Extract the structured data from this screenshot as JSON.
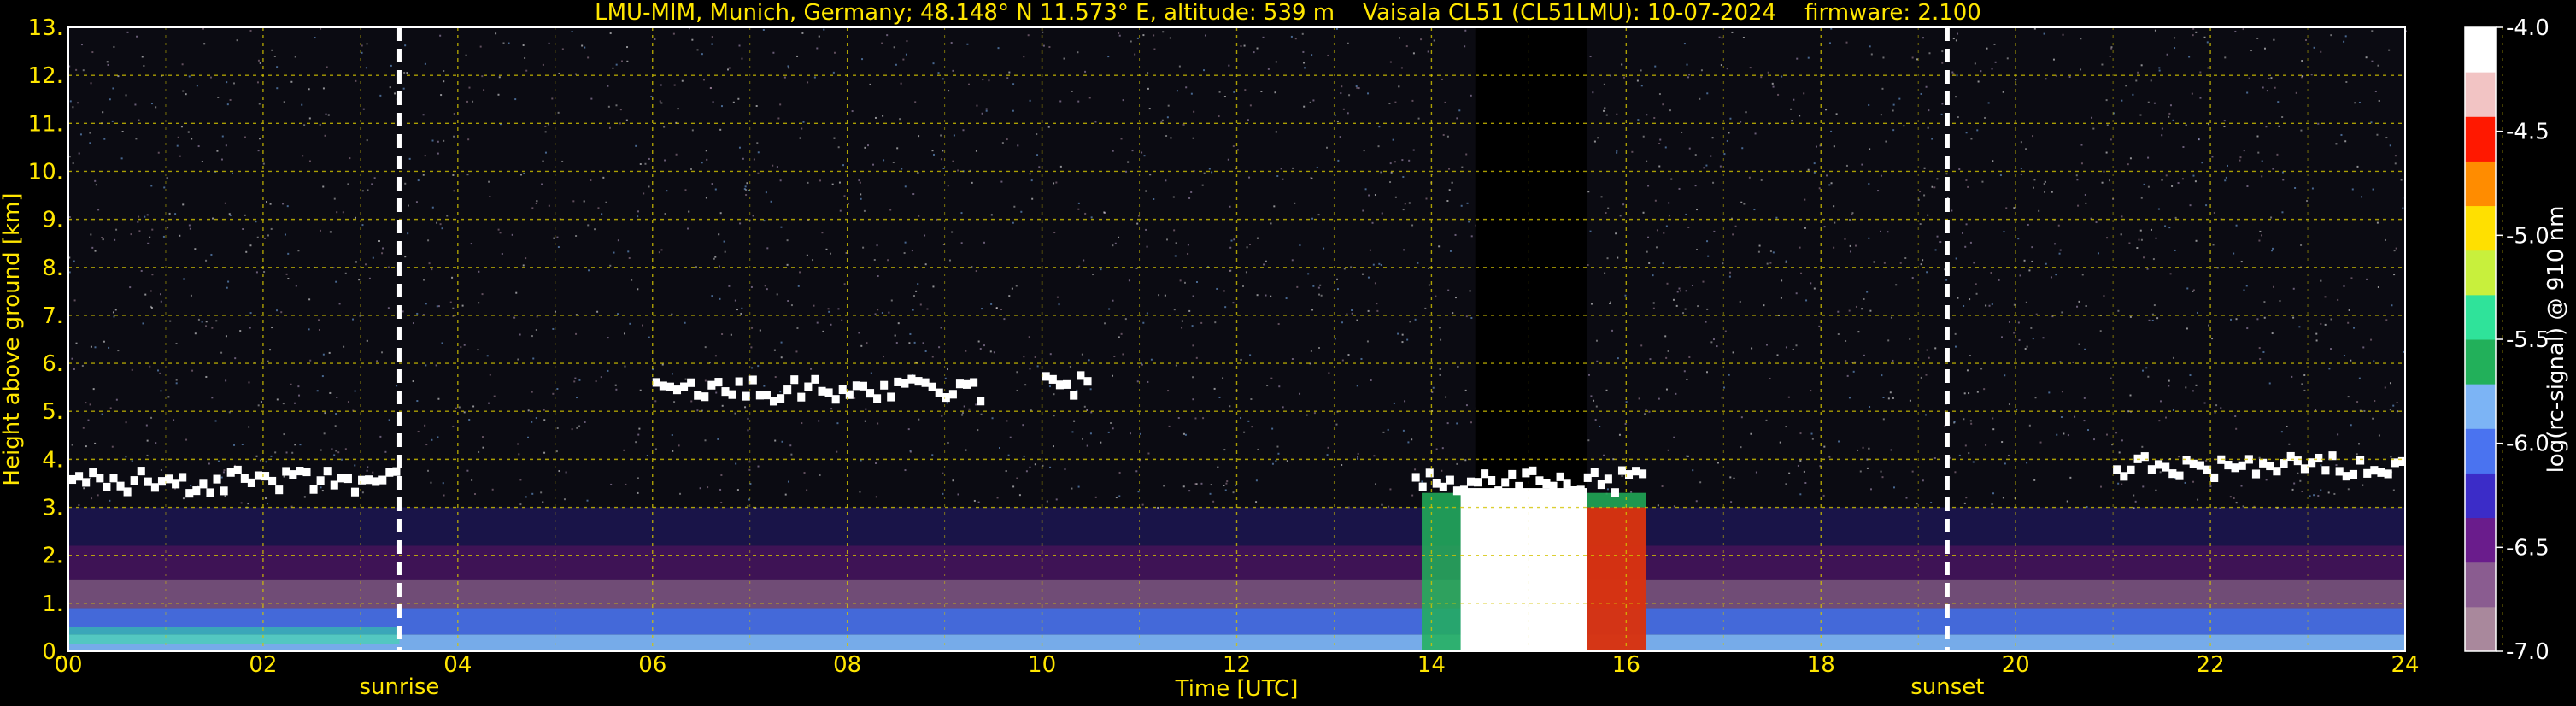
{
  "title": "LMU-MIM, Munich, Germany; 48.148° N 11.573° E, altitude: 539 m    Vaisala CL51 (CL51LMU): 10-07-2024    firmware: 2.100",
  "colors": {
    "text": "#ffe600",
    "grid": "#d4c400",
    "background": "#000000",
    "marker_line": "#ffffff"
  },
  "chart_data": {
    "type": "heatmap",
    "title": "LMU-MIM, Munich, Germany; 48.148° N 11.573° E, altitude: 539 m    Vaisala CL51 (CL51LMU): 10-07-2024    firmware: 2.100",
    "xlabel": "Time [UTC]",
    "ylabel": "Height above ground [km]",
    "xlim": [
      0,
      24
    ],
    "ylim": [
      0,
      13
    ],
    "x_ticks": [
      0,
      2,
      4,
      6,
      8,
      10,
      12,
      14,
      16,
      18,
      20,
      22,
      24
    ],
    "x_tick_labels": [
      "00",
      "02",
      "04",
      "06",
      "08",
      "10",
      "12",
      "14",
      "16",
      "18",
      "20",
      "22",
      "24"
    ],
    "y_ticks": [
      0,
      1,
      2,
      3,
      4,
      5,
      6,
      7,
      8,
      9,
      10,
      11,
      12,
      13
    ],
    "y_tick_labels": [
      "0.",
      "1.",
      "2.",
      "3.",
      "4.",
      "5.",
      "6.",
      "7.",
      "8.",
      "9.",
      "10.",
      "11.",
      "12.",
      "13."
    ],
    "grid": true,
    "vertical_markers": [
      {
        "label": "sunrise",
        "time": 3.4
      },
      {
        "label": "sunset",
        "time": 19.3
      }
    ],
    "colorbar": {
      "label": "log(rc-signal) @ 910 nm",
      "range": [
        -7.0,
        -4.0
      ],
      "ticks": [
        -7.0,
        -6.5,
        -6.0,
        -5.5,
        -5.0,
        -4.5,
        -4.0
      ],
      "tick_labels": [
        "-7.0",
        "-6.5",
        "-6.0",
        "-5.5",
        "-5.0",
        "-4.5",
        "-4.0"
      ],
      "colors": [
        "#a9889c",
        "#8a5c90",
        "#6a1c8c",
        "#3b2cc8",
        "#4a73f0",
        "#7cb4f5",
        "#22b05a",
        "#2fe39a",
        "#c8f03c",
        "#ffe000",
        "#ff8c00",
        "#ff1800",
        "#f2c4c4",
        "#ffffff"
      ]
    },
    "features": [
      {
        "label": "cloud layer",
        "start": 0.0,
        "end": 3.4,
        "height": 3.5
      },
      {
        "label": "cloud layer",
        "start": 6.0,
        "end": 9.4,
        "height": 5.4
      },
      {
        "label": "cloud layer",
        "start": 10.0,
        "end": 10.5,
        "height": 5.5
      },
      {
        "label": "cloud layer",
        "start": 13.8,
        "end": 16.2,
        "height": 3.5
      },
      {
        "label": "cloud layer",
        "start": 21.0,
        "end": 24.0,
        "height": 3.8
      }
    ]
  }
}
